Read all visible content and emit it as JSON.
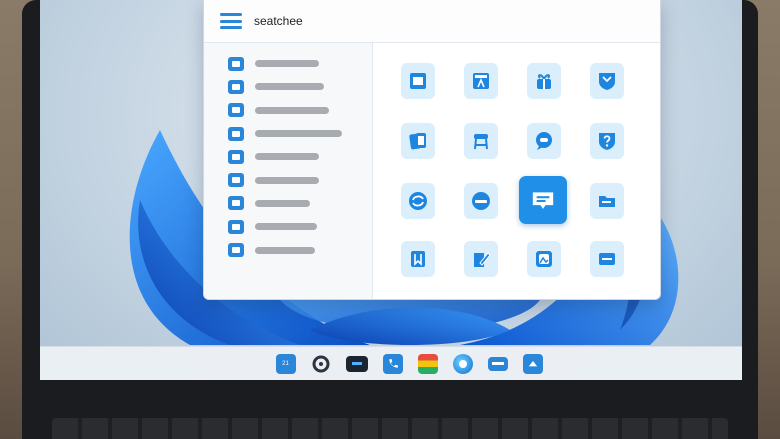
{
  "window": {
    "title": "seatchee",
    "accent_color": "#2a86d8",
    "sidebar": {
      "items": [
        {
          "icon": "app-icon"
        },
        {
          "icon": "folder-icon"
        },
        {
          "icon": "cloud-icon"
        },
        {
          "icon": "mail-icon"
        },
        {
          "icon": "note-icon"
        },
        {
          "icon": "grid-icon"
        },
        {
          "icon": "flag-icon"
        },
        {
          "icon": "media-icon"
        },
        {
          "icon": "document-icon"
        }
      ]
    },
    "grid": {
      "tiles": [
        {
          "icon": "window-icon"
        },
        {
          "icon": "calculator-icon"
        },
        {
          "icon": "gift-icon"
        },
        {
          "icon": "shield-icon"
        },
        {
          "icon": "cards-icon"
        },
        {
          "icon": "stool-icon"
        },
        {
          "icon": "chat-bubble-icon"
        },
        {
          "icon": "help-shield-icon"
        },
        {
          "icon": "sync-icon"
        },
        {
          "icon": "browser-icon"
        },
        {
          "icon": "message-icon",
          "selected": true
        },
        {
          "icon": "folder-icon"
        },
        {
          "icon": "book-icon"
        },
        {
          "icon": "edit-icon"
        },
        {
          "icon": "photo-icon"
        },
        {
          "icon": "keyboard-icon"
        }
      ]
    }
  },
  "taskbar": {
    "items": [
      {
        "icon": "calendar-icon",
        "label": "21"
      },
      {
        "icon": "search-icon"
      },
      {
        "icon": "terminal-icon"
      },
      {
        "icon": "phone-icon"
      },
      {
        "icon": "files-icon"
      },
      {
        "icon": "edge-icon"
      },
      {
        "icon": "explorer-icon"
      },
      {
        "icon": "store-icon"
      }
    ]
  }
}
